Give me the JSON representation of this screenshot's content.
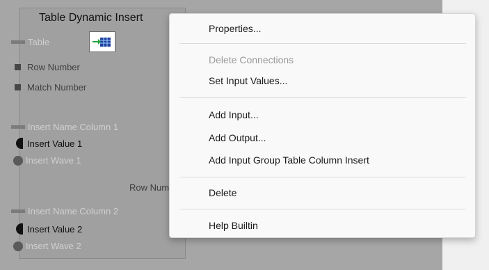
{
  "block": {
    "title": "Table Dynamic Insert",
    "icon": "table-insert-icon",
    "inputs": [
      {
        "label": "Table",
        "kind": "table"
      },
      {
        "label": "Row Number",
        "kind": "number"
      },
      {
        "label": "Match Number",
        "kind": "number"
      },
      {
        "label": "Insert Name Column 1",
        "kind": "string"
      },
      {
        "label": "Insert Value 1",
        "kind": "value"
      },
      {
        "label": "Insert Wave 1",
        "kind": "wave"
      },
      {
        "label": "Insert Name Column 2",
        "kind": "string"
      },
      {
        "label": "Insert Value 2",
        "kind": "value"
      },
      {
        "label": "Insert Wave 2",
        "kind": "wave"
      }
    ],
    "outputs": [
      {
        "label": "Row Number"
      }
    ]
  },
  "context_menu": {
    "items": [
      {
        "label": "Properties...",
        "enabled": true
      },
      {
        "label": "Delete Connections",
        "enabled": false
      },
      {
        "label": "Set Input Values...",
        "enabled": true
      },
      {
        "label": "Add Input...",
        "enabled": true
      },
      {
        "label": "Add Output...",
        "enabled": true
      },
      {
        "label": "Add Input Group Table Column Insert",
        "enabled": true
      },
      {
        "label": "Delete",
        "enabled": true
      },
      {
        "label": "Help Builtin",
        "enabled": true
      }
    ]
  },
  "colors": {
    "canvas": "#a6a6a6",
    "menu_background": "#f9f9f9",
    "disabled_text": "#9a9a9a"
  }
}
